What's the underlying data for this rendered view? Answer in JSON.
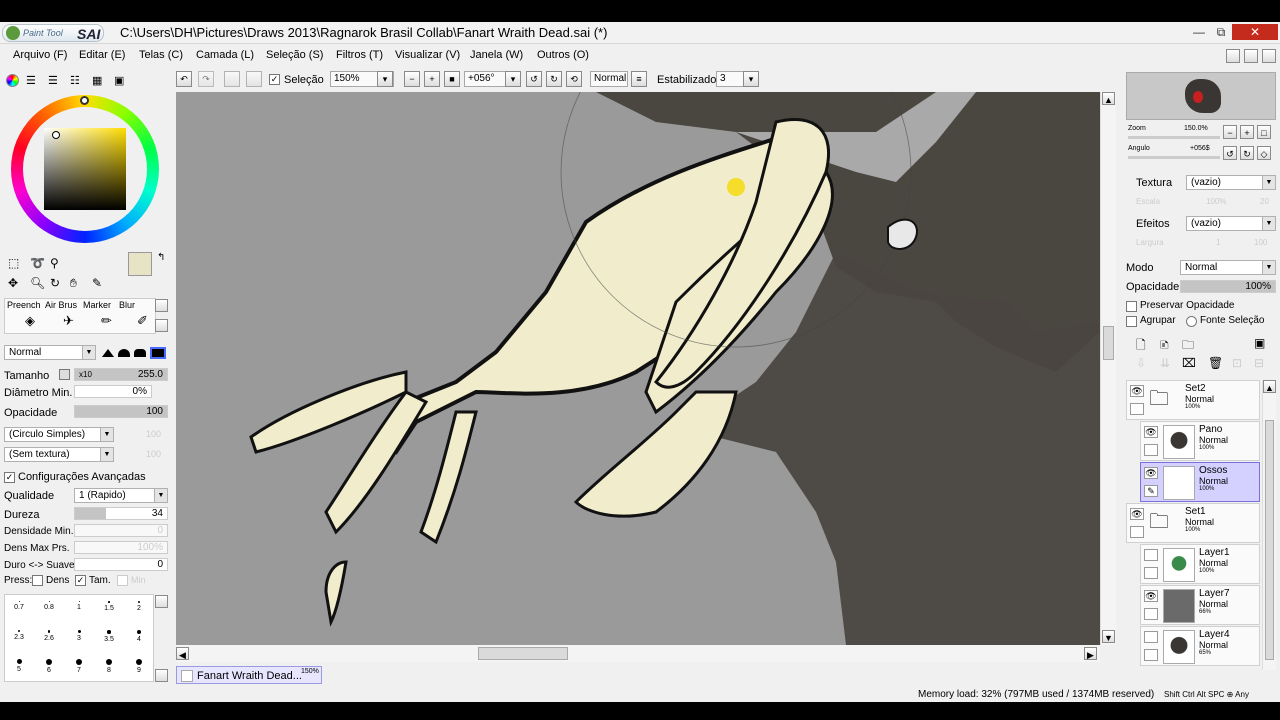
{
  "window": {
    "app_name": "SAI",
    "app_prefix": "Paint Tool",
    "title": "C:\\Users\\DH\\Pictures\\Draws 2013\\Ragnarok Brasil Collab\\Fanart Wraith Dead.sai (*)",
    "min": "—",
    "max": "⧉",
    "close": "✕"
  },
  "menu": [
    "Arquivo (F)",
    "Editar (E)",
    "Telas (C)",
    "Camada (L)",
    "Seleção (S)",
    "Filtros (T)",
    "Visualizar (V)",
    "Janela (W)",
    "Outros (O)"
  ],
  "toolbar": {
    "selecao_label": "Seleção",
    "selecao_checked": true,
    "zoom": "150%",
    "angle": "+056°",
    "mode": "Normal",
    "stabilizer_label": "Estabilizador",
    "stabilizer": "3"
  },
  "colors": {
    "primary": "#e7e4c6",
    "secondary": "#ffffff",
    "canvas_bg": "#9a9a9a",
    "bone": "#f0eccc",
    "shadow": "#4a4640",
    "selected_layer": "#d4d0ff"
  },
  "tools": {
    "brush_names": [
      "Preench",
      "Air Brus",
      "Marker",
      "Blur"
    ],
    "blend_mode": "Normal"
  },
  "brush": {
    "tamanho_label": "Tamanho",
    "tamanho_mult": "x10",
    "tamanho": "255.0",
    "diametro_label": "Diâmetro Min.",
    "diametro": "0%",
    "opacidade_label": "Opacidade",
    "opacidade": "100",
    "shape": "(Circulo Simples)",
    "texture": "(Sem textura)",
    "shape_val": "100",
    "texture_val": "100",
    "advanced_label": "Configurações Avançadas",
    "advanced_checked": true,
    "qualidade_label": "Qualidade",
    "qualidade": "1 (Rapido)",
    "dureza_label": "Dureza",
    "dureza": "34",
    "densidade_label": "Densidade Min.",
    "densidade": "0",
    "densmax_label": "Dens Max Prs.",
    "densmax": "100%",
    "duro_label": "Duro <-> Suave",
    "duro": "0",
    "press_label": "Press:",
    "dens_label": "Dens",
    "tam_label": "Tam.",
    "min_label": "Min",
    "dens_checked": false,
    "tam_checked": true
  },
  "brush_sizes": [
    "0.7",
    "0.8",
    "1",
    "1.5",
    "2",
    "2.3",
    "2.6",
    "3",
    "3.5",
    "4",
    "5",
    "6",
    "7",
    "8",
    "9"
  ],
  "navigator": {
    "zoom_label": "Zoom",
    "zoom": "150.0%",
    "angle_label": "Angulo",
    "angle": "+056$"
  },
  "layer_props": {
    "textura_label": "Textura",
    "textura": "(vazio)",
    "efeitos_label": "Efeitos",
    "efeitos": "(vazio)",
    "modo_label": "Modo",
    "modo": "Normal",
    "opacidade_label": "Opacidade",
    "opacidade": "100%",
    "preserve_label": "Preservar Opacidade",
    "agrupar_label": "Agrupar",
    "fonte_label": "Fonte Seleção",
    "escala_label": "Escala",
    "escala": "100%",
    "escala2": "20",
    "largura_label": "Largura",
    "largura": "1",
    "largura2": "100"
  },
  "layers": [
    {
      "name": "Set2",
      "mode": "Normal",
      "opacity": "100%",
      "folder": true,
      "visible": true
    },
    {
      "name": "Pano",
      "mode": "Normal",
      "opacity": "100%",
      "folder": false,
      "visible": true
    },
    {
      "name": "Ossos",
      "mode": "Normal",
      "opacity": "100%",
      "folder": false,
      "visible": true,
      "selected": true
    },
    {
      "name": "Set1",
      "mode": "Normal",
      "opacity": "100%",
      "folder": true,
      "visible": true
    },
    {
      "name": "Layer1",
      "mode": "Normal",
      "opacity": "100%",
      "folder": false,
      "visible": false
    },
    {
      "name": "Layer7",
      "mode": "Normal",
      "opacity": "66%",
      "folder": false,
      "visible": true
    },
    {
      "name": "Layer4",
      "mode": "Normal",
      "opacity": "65%",
      "folder": false,
      "visible": false
    }
  ],
  "tab": {
    "name": "Fanart Wraith Dead...",
    "zoom": "150%"
  },
  "status": {
    "memory": "Memory load: 32% (797MB used / 1374MB reserved)",
    "keys": "Shift Ctrl Alt SPC ⊕ Any"
  }
}
